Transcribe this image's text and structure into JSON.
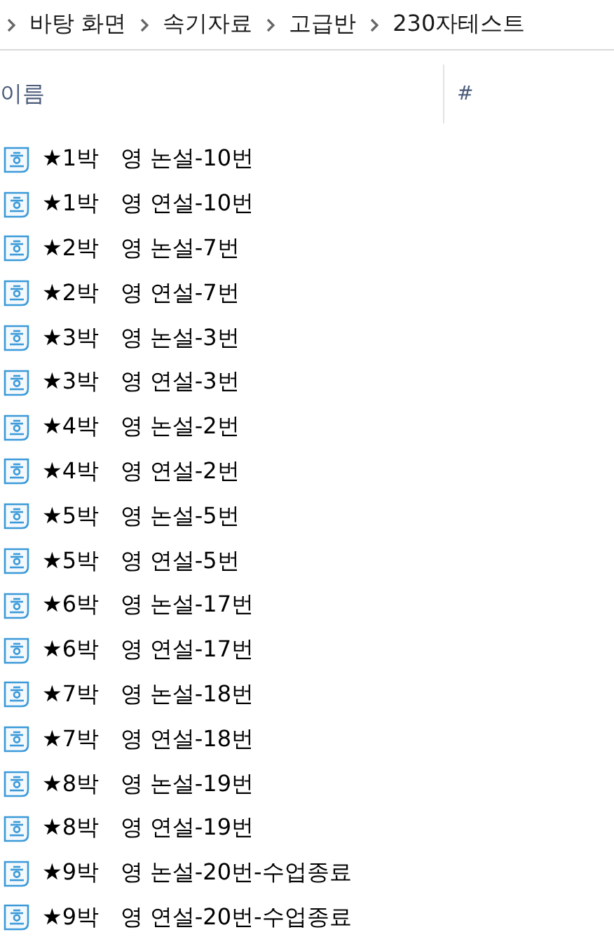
{
  "breadcrumb": [
    "바탕 화면",
    "속기자료",
    "고급반",
    "230자테스트"
  ],
  "columns": [
    "이름",
    "#"
  ],
  "files": [
    {
      "name": "★1박   영 논설-10번"
    },
    {
      "name": "★1박   영 연설-10번"
    },
    {
      "name": "★2박   영 논설-7번"
    },
    {
      "name": "★2박   영 연설-7번"
    },
    {
      "name": "★3박   영 논설-3번"
    },
    {
      "name": "★3박   영 연설-3번"
    },
    {
      "name": "★4박   영 논설-2번"
    },
    {
      "name": "★4박   영 연설-2번"
    },
    {
      "name": "★5박   영 논설-5번"
    },
    {
      "name": "★5박   영 연설-5번"
    },
    {
      "name": "★6박   영 논설-17번"
    },
    {
      "name": "★6박   영 연설-17번"
    },
    {
      "name": "★7박   영 논설-18번"
    },
    {
      "name": "★7박   영 연설-18번"
    },
    {
      "name": "★8박   영 논설-19번"
    },
    {
      "name": "★8박   영 연설-19번"
    },
    {
      "name": "★9박   영 논설-20번-수업종료"
    },
    {
      "name": "★9박   영 연설-20번-수업종료"
    }
  ]
}
